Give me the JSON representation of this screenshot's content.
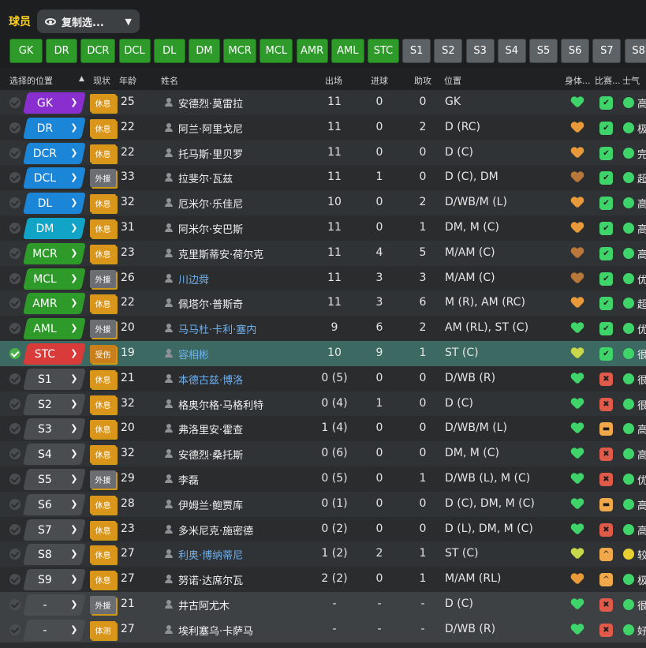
{
  "header": {
    "title": "球员",
    "view_label": "复制选..."
  },
  "positions": [
    {
      "label": "GK",
      "color": "green"
    },
    {
      "label": "DR",
      "color": "green"
    },
    {
      "label": "DCR",
      "color": "green"
    },
    {
      "label": "DCL",
      "color": "green"
    },
    {
      "label": "DL",
      "color": "green"
    },
    {
      "label": "DM",
      "color": "green"
    },
    {
      "label": "MCR",
      "color": "green"
    },
    {
      "label": "MCL",
      "color": "green"
    },
    {
      "label": "AMR",
      "color": "green"
    },
    {
      "label": "AML",
      "color": "green"
    },
    {
      "label": "STC",
      "color": "green"
    },
    {
      "label": "S1",
      "color": "gray"
    },
    {
      "label": "S2",
      "color": "gray"
    },
    {
      "label": "S3",
      "color": "gray"
    },
    {
      "label": "S4",
      "color": "gray"
    },
    {
      "label": "S5",
      "color": "gray"
    },
    {
      "label": "S6",
      "color": "gray"
    },
    {
      "label": "S7",
      "color": "gray"
    },
    {
      "label": "S8",
      "color": "gray"
    }
  ],
  "columns": {
    "selected_pos": "选择的位置",
    "status": "现状",
    "age": "年龄",
    "name": "姓名",
    "apps": "出场",
    "goals": "进球",
    "assists": "助攻",
    "position": "位置",
    "condition": "身体...",
    "match": "比赛...",
    "morale": "士气"
  },
  "colors": {
    "gk": "#8a2fcf",
    "def": "#1b86d8",
    "dm": "#12a4c6",
    "mid": "#2e9a2a",
    "st": "#d93a3a",
    "sub": "#4a4d50",
    "heart_green": "#3fd46a",
    "heart_orange": "#e89a3a",
    "heart_brown": "#b9783a",
    "heart_yellow": "#c8d84a"
  },
  "players": [
    {
      "pos": "GK",
      "poscolor": "#8a2fcf",
      "status": "休息",
      "stype": "rest",
      "age": "25",
      "name": "安德烈·莫雷拉",
      "blue": false,
      "apps": "11",
      "goals": "0",
      "assists": "0",
      "position": "GK",
      "heart": "#3fd46a",
      "match": "#3fd46a",
      "matchsym": "✔",
      "morale": "#3fd46a",
      "moraletxt": "高"
    },
    {
      "pos": "DR",
      "poscolor": "#1b86d8",
      "status": "休息",
      "stype": "rest",
      "age": "22",
      "name": "阿兰·阿里戈尼",
      "blue": false,
      "apps": "11",
      "goals": "0",
      "assists": "2",
      "position": "D (RC)",
      "heart": "#e89a3a",
      "match": "#3fd46a",
      "matchsym": "✔",
      "morale": "#3fd46a",
      "moraletxt": "极"
    },
    {
      "pos": "DCR",
      "poscolor": "#1b86d8",
      "status": "休息",
      "stype": "rest",
      "age": "22",
      "name": "托马斯·里贝罗",
      "blue": false,
      "apps": "11",
      "goals": "0",
      "assists": "0",
      "position": "D (C)",
      "heart": "#e89a3a",
      "match": "#3fd46a",
      "matchsym": "✔",
      "morale": "#3fd46a",
      "moraletxt": "完"
    },
    {
      "pos": "DCL",
      "poscolor": "#1b86d8",
      "status": "外援",
      "stype": "loan",
      "age": "33",
      "name": "拉斐尔·瓦兹",
      "blue": false,
      "apps": "11",
      "goals": "1",
      "assists": "0",
      "position": "D (C), DM",
      "heart": "#b9783a",
      "match": "#3fd46a",
      "matchsym": "✔",
      "morale": "#3fd46a",
      "moraletxt": "超"
    },
    {
      "pos": "DL",
      "poscolor": "#1b86d8",
      "status": "休息",
      "stype": "rest",
      "age": "32",
      "name": "厄米尔·乐佳尼",
      "blue": false,
      "apps": "10",
      "goals": "0",
      "assists": "2",
      "position": "D/WB/M (L)",
      "heart": "#e89a3a",
      "match": "#3fd46a",
      "matchsym": "✔",
      "morale": "#3fd46a",
      "moraletxt": "高"
    },
    {
      "pos": "DM",
      "poscolor": "#12a4c6",
      "status": "休息",
      "stype": "rest",
      "age": "31",
      "name": "阿米尔·安巴斯",
      "blue": false,
      "apps": "11",
      "goals": "0",
      "assists": "1",
      "position": "DM, M (C)",
      "heart": "#e89a3a",
      "match": "#3fd46a",
      "matchsym": "✔",
      "morale": "#3fd46a",
      "moraletxt": "高"
    },
    {
      "pos": "MCR",
      "poscolor": "#2e9a2a",
      "status": "休息",
      "stype": "rest",
      "age": "23",
      "name": "克里斯蒂安·荷尔克",
      "blue": false,
      "apps": "11",
      "goals": "4",
      "assists": "5",
      "position": "M/AM (C)",
      "heart": "#b9783a",
      "match": "#3fd46a",
      "matchsym": "✔",
      "morale": "#3fd46a",
      "moraletxt": "高"
    },
    {
      "pos": "MCL",
      "poscolor": "#2e9a2a",
      "status": "外援",
      "stype": "loan",
      "age": "26",
      "name": "川边舜",
      "blue": true,
      "apps": "11",
      "goals": "3",
      "assists": "3",
      "position": "M/AM (C)",
      "heart": "#b9783a",
      "match": "#3fd46a",
      "matchsym": "✔",
      "morale": "#3fd46a",
      "moraletxt": "优"
    },
    {
      "pos": "AMR",
      "poscolor": "#2e9a2a",
      "status": "休息",
      "stype": "rest",
      "age": "22",
      "name": "佩塔尔·普斯奇",
      "blue": false,
      "apps": "11",
      "goals": "3",
      "assists": "6",
      "position": "M (R), AM (RC)",
      "heart": "#e89a3a",
      "match": "#3fd46a",
      "matchsym": "✔",
      "morale": "#3fd46a",
      "moraletxt": "超"
    },
    {
      "pos": "AML",
      "poscolor": "#2e9a2a",
      "status": "外援",
      "stype": "loan",
      "age": "20",
      "name": "马马杜·卡利·塞内",
      "blue": true,
      "apps": "9",
      "goals": "6",
      "assists": "2",
      "position": "AM (RL), ST (C)",
      "heart": "#3fd46a",
      "match": "#3fd46a",
      "matchsym": "✔",
      "morale": "#3fd46a",
      "moraletxt": "优"
    },
    {
      "pos": "STC",
      "poscolor": "#d93a3a",
      "status": "受伤",
      "stype": "inj",
      "age": "19",
      "name": "容相彬",
      "blue": true,
      "apps": "10",
      "goals": "9",
      "assists": "1",
      "position": "ST (C)",
      "heart": "#c8d84a",
      "match": "#3fd46a",
      "matchsym": "✔",
      "morale": "#3fd46a",
      "moraletxt": "很"
    },
    {
      "pos": "S1",
      "poscolor": "#4a4d50",
      "status": "休息",
      "stype": "rest",
      "age": "21",
      "name": "本德古兹·博洛",
      "blue": true,
      "apps": "0 (5)",
      "goals": "0",
      "assists": "0",
      "position": "D/WB (R)",
      "heart": "#3fd46a",
      "match": "#e05a4a",
      "matchsym": "✖",
      "morale": "#3fd46a",
      "moraletxt": "很"
    },
    {
      "pos": "S2",
      "poscolor": "#4a4d50",
      "status": "休息",
      "stype": "rest",
      "age": "32",
      "name": "格奥尔格·马格利特",
      "blue": false,
      "apps": "0 (4)",
      "goals": "1",
      "assists": "0",
      "position": "D (C)",
      "heart": "#3fd46a",
      "match": "#e05a4a",
      "matchsym": "✖",
      "morale": "#3fd46a",
      "moraletxt": "很"
    },
    {
      "pos": "S3",
      "poscolor": "#4a4d50",
      "status": "休息",
      "stype": "rest",
      "age": "20",
      "name": "弗洛里安·霍查",
      "blue": false,
      "apps": "1 (4)",
      "goals": "0",
      "assists": "0",
      "position": "D/WB/M (L)",
      "heart": "#3fd46a",
      "match": "#f0a84a",
      "matchsym": "▬",
      "morale": "#3fd46a",
      "moraletxt": "高"
    },
    {
      "pos": "S4",
      "poscolor": "#4a4d50",
      "status": "休息",
      "stype": "rest",
      "age": "32",
      "name": "安德烈·桑托斯",
      "blue": false,
      "apps": "0 (6)",
      "goals": "0",
      "assists": "0",
      "position": "DM, M (C)",
      "heart": "#3fd46a",
      "match": "#e05a4a",
      "matchsym": "✖",
      "morale": "#3fd46a",
      "moraletxt": "高"
    },
    {
      "pos": "S5",
      "poscolor": "#4a4d50",
      "status": "外援",
      "stype": "loan",
      "age": "29",
      "name": "李磊",
      "blue": false,
      "apps": "0 (5)",
      "goals": "0",
      "assists": "1",
      "position": "D/WB (L), M (C)",
      "heart": "#3fd46a",
      "match": "#e05a4a",
      "matchsym": "✖",
      "morale": "#3fd46a",
      "moraletxt": "优"
    },
    {
      "pos": "S6",
      "poscolor": "#4a4d50",
      "status": "休息",
      "stype": "rest",
      "age": "28",
      "name": "伊姆兰·鲍贾库",
      "blue": false,
      "apps": "0 (1)",
      "goals": "0",
      "assists": "0",
      "position": "D (C), DM, M (C)",
      "heart": "#3fd46a",
      "match": "#f0a84a",
      "matchsym": "▬",
      "morale": "#3fd46a",
      "moraletxt": "高"
    },
    {
      "pos": "S7",
      "poscolor": "#4a4d50",
      "status": "休息",
      "stype": "rest",
      "age": "23",
      "name": "多米尼克·施密德",
      "blue": false,
      "apps": "0 (2)",
      "goals": "0",
      "assists": "0",
      "position": "D (L), DM, M (C)",
      "heart": "#3fd46a",
      "match": "#e05a4a",
      "matchsym": "✖",
      "morale": "#3fd46a",
      "moraletxt": "高"
    },
    {
      "pos": "S8",
      "poscolor": "#4a4d50",
      "status": "休息",
      "stype": "rest",
      "age": "27",
      "name": "利奥·博纳蒂尼",
      "blue": true,
      "apps": "1 (2)",
      "goals": "2",
      "assists": "1",
      "position": "ST (C)",
      "heart": "#c8d84a",
      "match": "#f0a84a",
      "matchsym": "^",
      "morale": "#e8d030",
      "moraletxt": "较"
    },
    {
      "pos": "S9",
      "poscolor": "#4a4d50",
      "status": "休息",
      "stype": "rest",
      "age": "27",
      "name": "努诺·达席尔瓦",
      "blue": false,
      "apps": "2 (2)",
      "goals": "0",
      "assists": "1",
      "position": "M/AM (RL)",
      "heart": "#e89a3a",
      "match": "#f0a84a",
      "matchsym": "^",
      "morale": "#3fd46a",
      "moraletxt": "极"
    },
    {
      "pos": "-",
      "poscolor": "#4a4d50",
      "status": "外援",
      "stype": "loan",
      "age": "21",
      "name": "井古阿尤木",
      "blue": false,
      "apps": "-",
      "goals": "-",
      "assists": "-",
      "position": "D (C)",
      "heart": "#3fd46a",
      "match": "#e05a4a",
      "matchsym": "✖",
      "morale": "#3fd46a",
      "moraletxt": "很"
    },
    {
      "pos": "-",
      "poscolor": "#4a4d50",
      "status": "体测",
      "stype": "rest",
      "age": "27",
      "name": "埃利塞乌·卡萨马",
      "blue": false,
      "apps": "-",
      "goals": "-",
      "assists": "-",
      "position": "D/WB (R)",
      "heart": "#3fd46a",
      "match": "#e05a4a",
      "matchsym": "✖",
      "morale": "#3fd46a",
      "moraletxt": "好"
    }
  ]
}
